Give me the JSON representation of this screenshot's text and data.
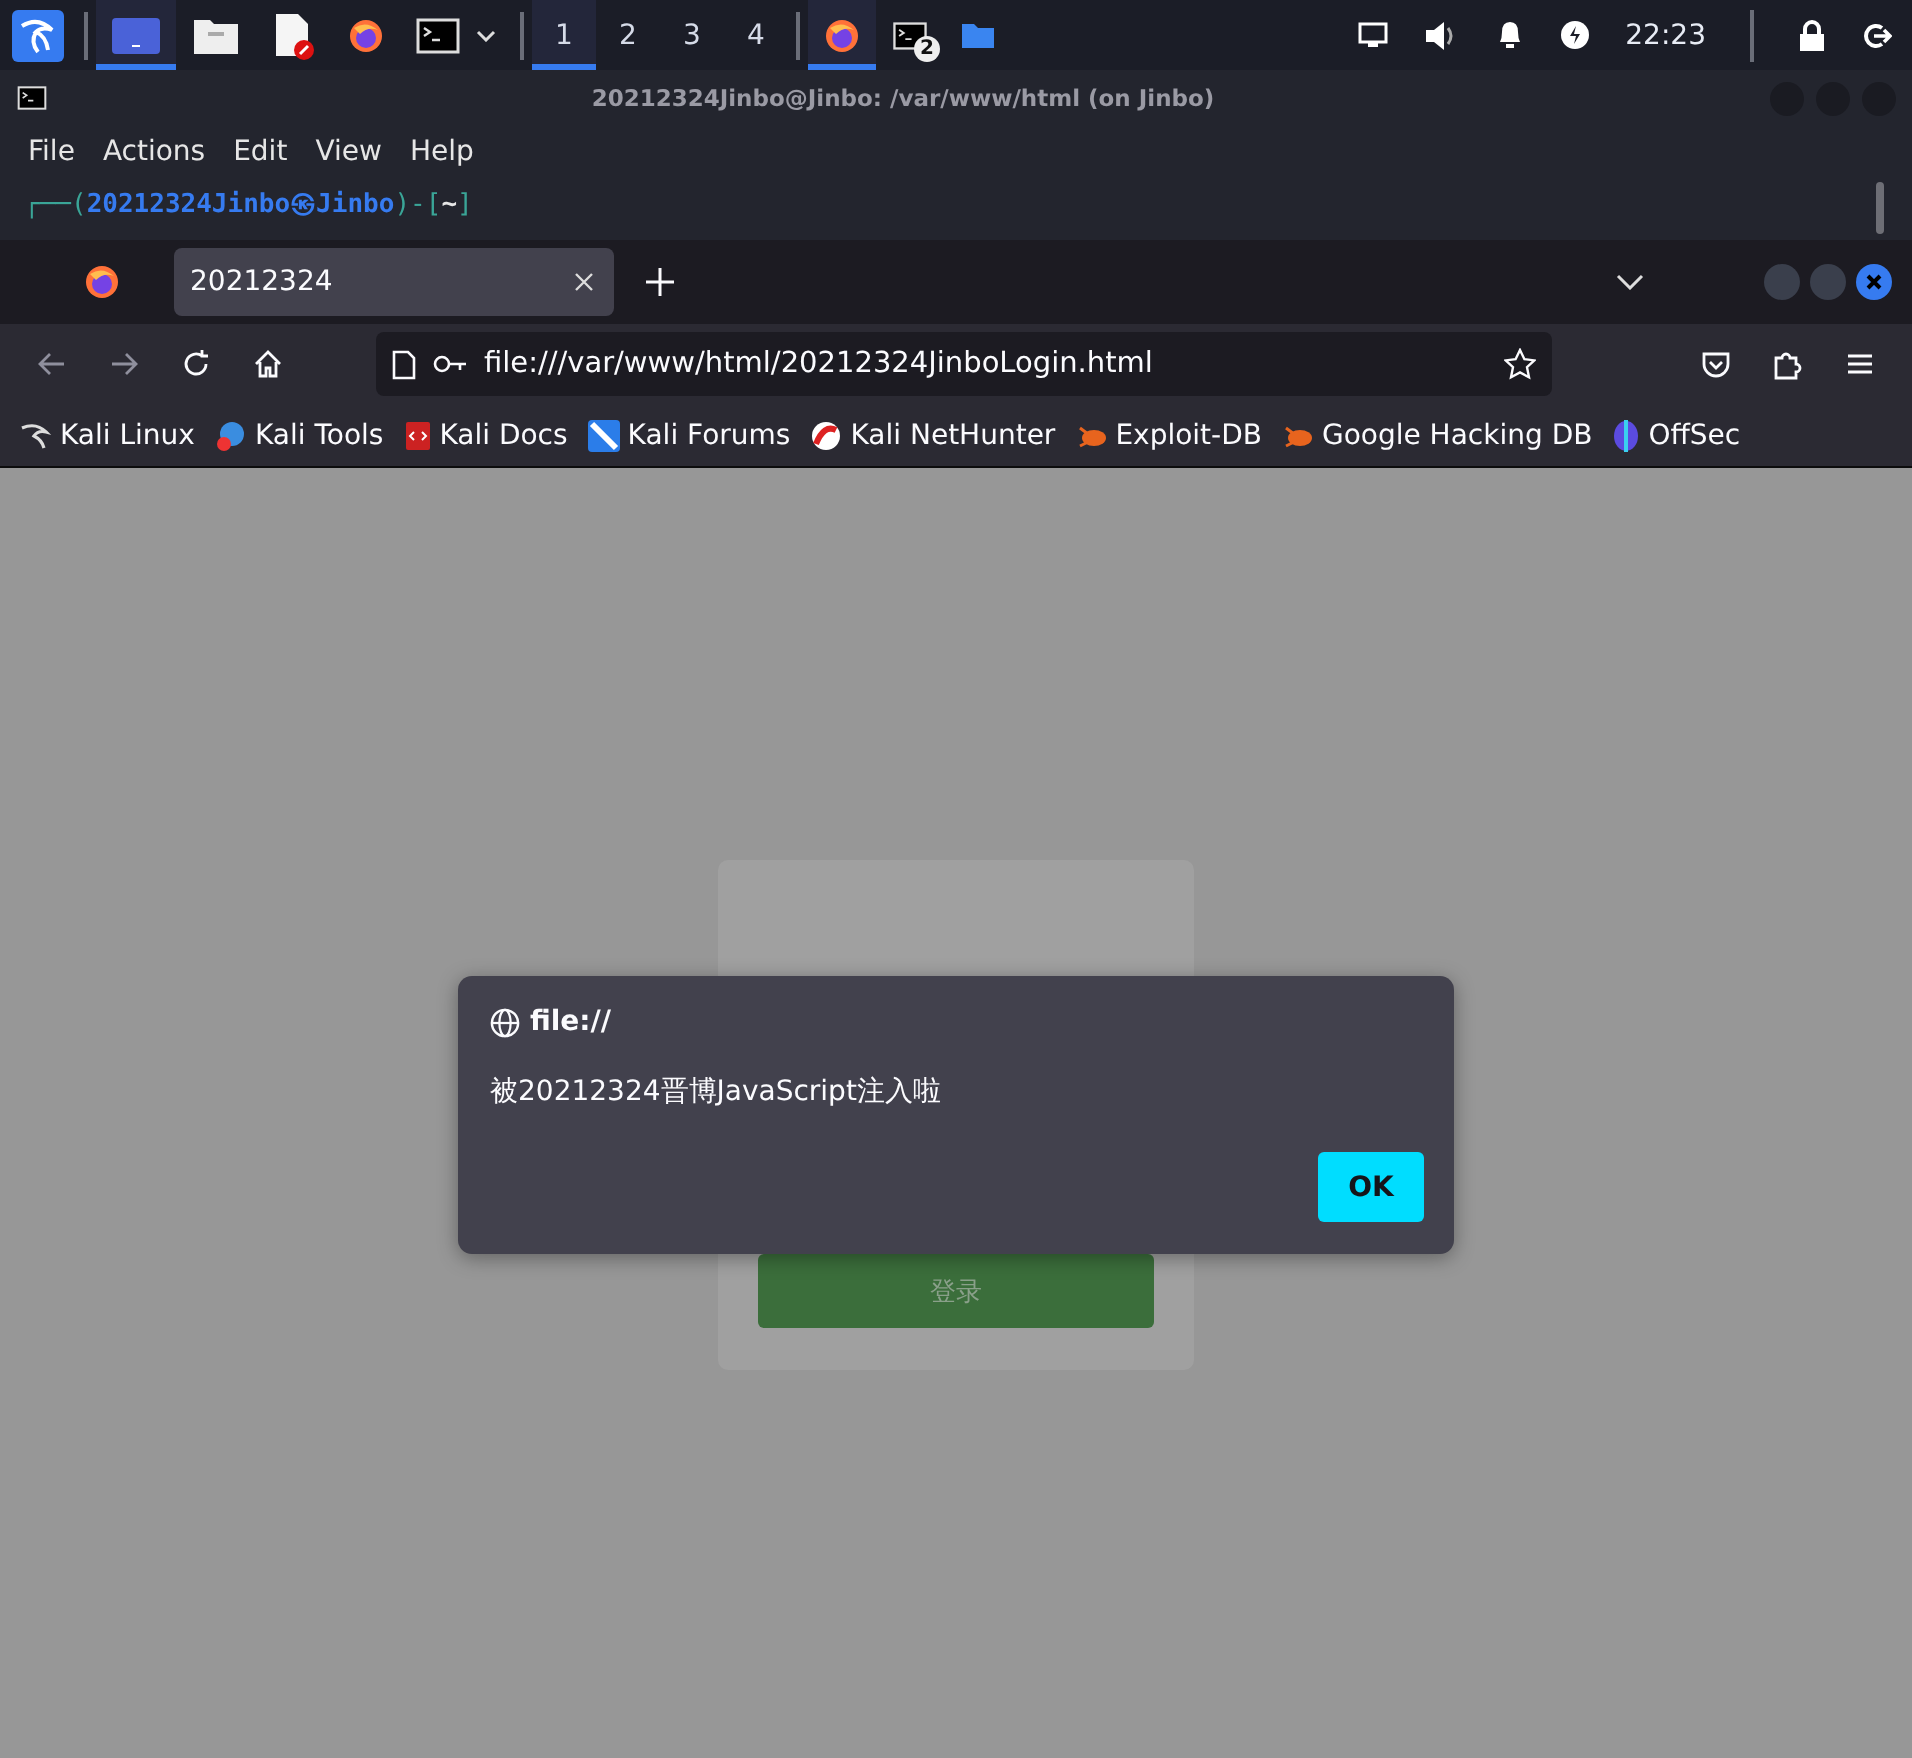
{
  "taskbar": {
    "launchers": [
      {
        "kind": "kali"
      },
      {
        "kind": "desktop",
        "selected": true
      },
      {
        "kind": "files",
        "selected": false
      },
      {
        "kind": "editor",
        "selected": false
      },
      {
        "kind": "firefox",
        "selected": false
      },
      {
        "kind": "terminal",
        "selected": false
      }
    ],
    "workspaces": [
      {
        "label": "1",
        "selected": true
      },
      {
        "label": "2",
        "selected": false
      },
      {
        "label": "3",
        "selected": false
      },
      {
        "label": "4",
        "selected": false
      }
    ],
    "tasks": [
      {
        "kind": "firefox",
        "selected": true
      },
      {
        "kind": "terminal",
        "selected": false,
        "badge": "2"
      },
      {
        "kind": "folder",
        "selected": false
      }
    ],
    "clock": "22:23"
  },
  "terminal": {
    "title": "20212324Jinbo@Jinbo: /var/www/html (on Jinbo)",
    "menu": [
      "File",
      "Actions",
      "Edit",
      "View",
      "Help"
    ],
    "prompt": [
      {
        "text": "┌──(",
        "kind": "frame"
      },
      {
        "text": "20212324Jinbo㉿Jinbo",
        "kind": "user"
      },
      {
        "text": ")-[",
        "kind": "frame"
      },
      {
        "text": "~",
        "kind": "dir"
      },
      {
        "text": "]",
        "kind": "frame"
      }
    ]
  },
  "browser": {
    "tabs": [
      {
        "title": "20212324",
        "selected": true
      }
    ],
    "url": "file:///var/www/html/20212324JinboLogin.html",
    "bookmarks": [
      {
        "label": "Kali Linux",
        "kind": "dragon"
      },
      {
        "label": "Kali Tools",
        "kind": "tools"
      },
      {
        "label": "Kali Docs",
        "kind": "docs"
      },
      {
        "label": "Kali Forums",
        "kind": "forums"
      },
      {
        "label": "Kali NetHunter",
        "kind": "nethunter"
      },
      {
        "label": "Exploit-DB",
        "kind": "bug"
      },
      {
        "label": "Google Hacking DB",
        "kind": "bug"
      },
      {
        "label": "OffSec",
        "kind": "offsec"
      }
    ],
    "page": {
      "button": "登录"
    },
    "dialog": {
      "origin": "file://",
      "message": "被20212324晋博JavaScript注入啦",
      "ok": "OK"
    }
  }
}
